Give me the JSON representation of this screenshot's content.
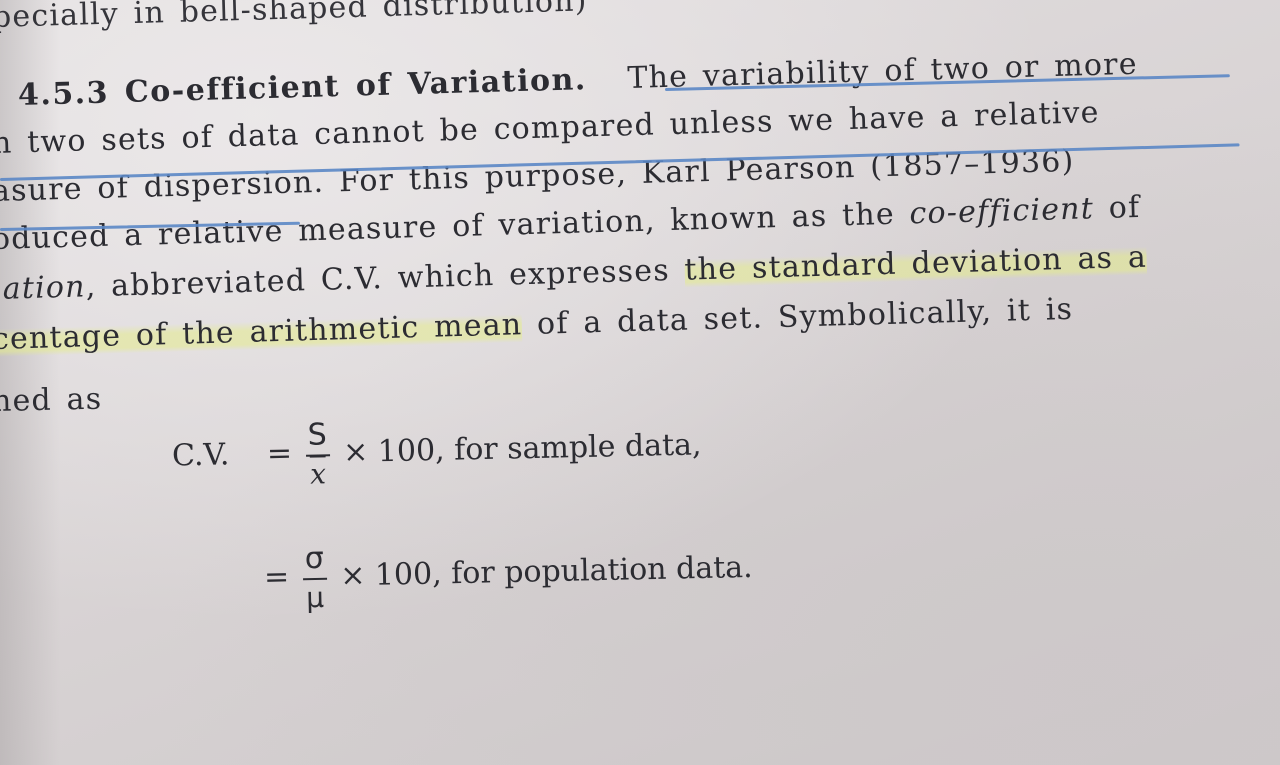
{
  "page": {
    "lines": [
      "pecially in bell-shaped distribution)",
      "The variability of two or more",
      "n two sets of data cannot be compared unless we have a relative",
      "asure of dispersion. For this purpose, Karl Pearson (1857–1936)",
      "oduced a relative measure of variation, known as the",
      "co-efficient",
      "of",
      "iation",
      ", abbreviated C.V. which expresses",
      "the standard deviation as a",
      "centage of the arithmetic mean",
      "of a data set. Symbolically, it is",
      "ned as"
    ],
    "heading": "4.5.3 Co-efficient of Variation.",
    "formula": {
      "lhs": "C.V.",
      "eq": "=",
      "sample": {
        "num": "S",
        "den": "x",
        "rest": "× 100,  for sample data,"
      },
      "population": {
        "num": "σ",
        "den": "μ",
        "rest": "× 100, for population data."
      }
    }
  },
  "colors": {
    "ink_underline": "#5b87c5",
    "highlight": "#e4ec8c",
    "text": "#2c2c32"
  }
}
